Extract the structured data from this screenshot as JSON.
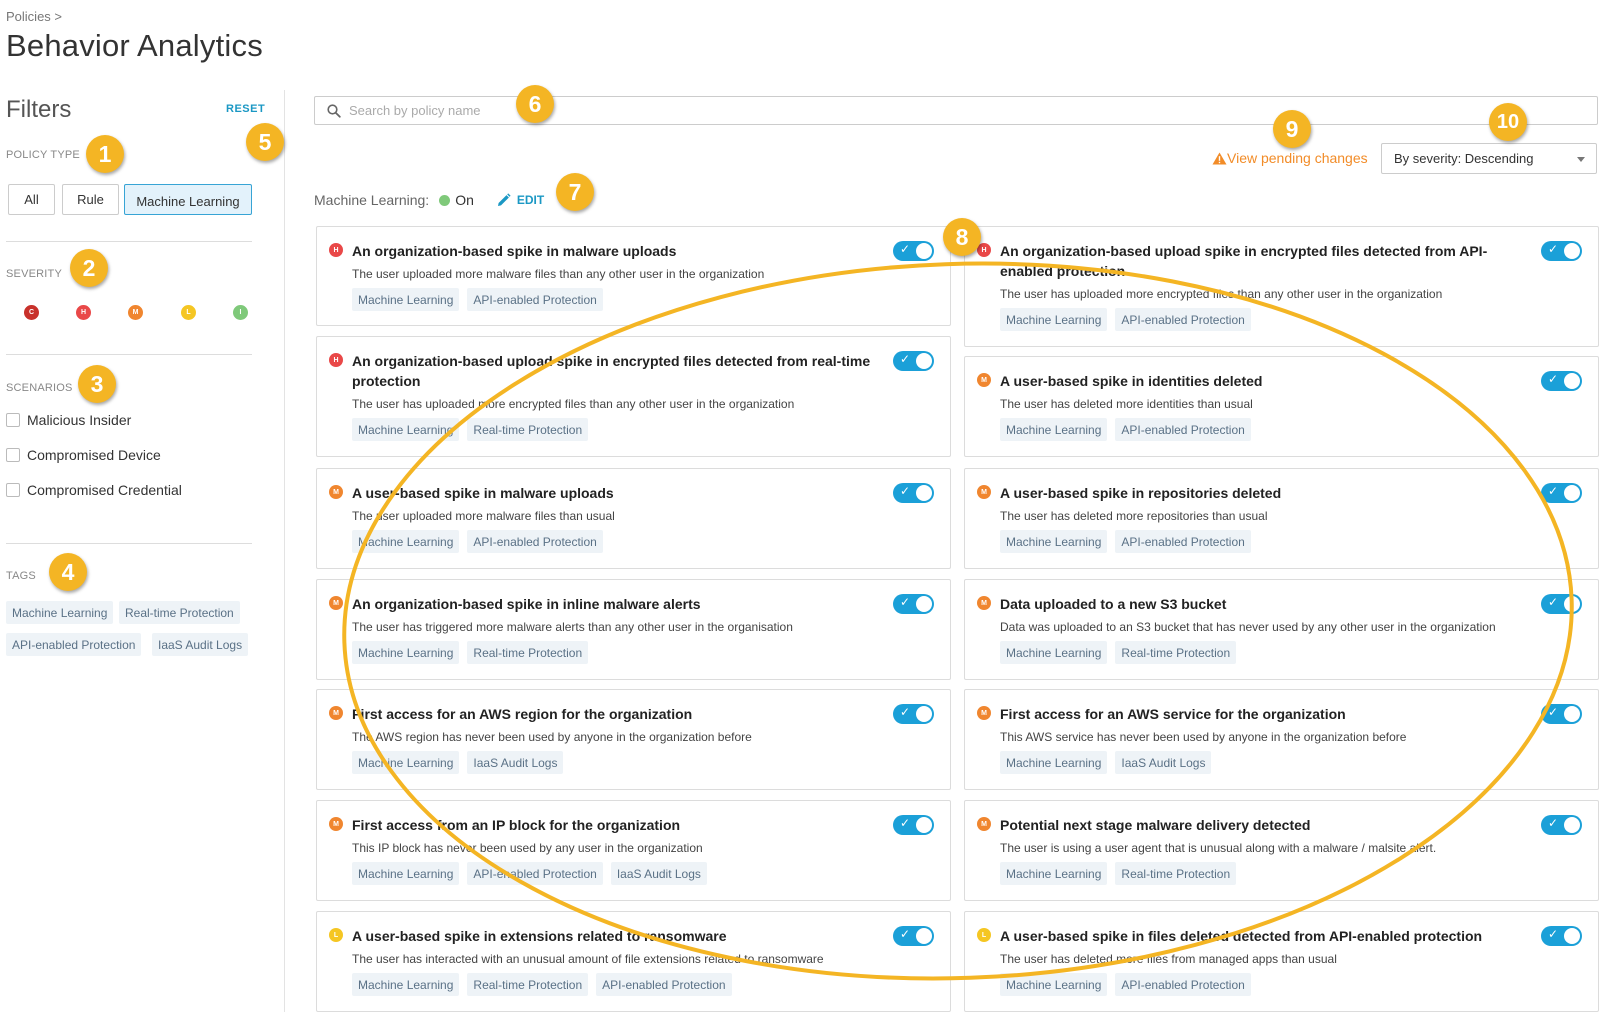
{
  "breadcrumb": "Policies >",
  "page_title": "Behavior Analytics",
  "filters": {
    "title": "Filters",
    "reset_label": "RESET",
    "policy_type_label": "POLICY TYPE",
    "policy_types": [
      "All",
      "Rule",
      "Machine Learning"
    ],
    "severity_label": "SEVERITY",
    "severities": [
      {
        "letter": "C",
        "color": "#c8312b"
      },
      {
        "letter": "H",
        "color": "#e94848"
      },
      {
        "letter": "M",
        "color": "#f0862f"
      },
      {
        "letter": "L",
        "color": "#f5c623"
      },
      {
        "letter": "I",
        "color": "#7fc97a"
      }
    ],
    "scenarios_label": "SCENARIOS",
    "scenarios": [
      "Malicious Insider",
      "Compromised Device",
      "Compromised Credential"
    ],
    "tags_label": "TAGS",
    "tags": [
      "Machine Learning",
      "Real-time Protection",
      "API-enabled Protection",
      "IaaS Audit Logs"
    ]
  },
  "search": {
    "placeholder": "Search by policy name"
  },
  "pending_changes_label": "View pending changes",
  "sort": {
    "selected": "By severity: Descending"
  },
  "machine_learning": {
    "label": "Machine Learning:",
    "status": "On",
    "edit_label": "EDIT"
  },
  "policies": [
    {
      "severity": "H",
      "title": "An organization-based spike in malware uploads",
      "description": "The user uploaded more malware files than any other user in the organization",
      "tags": [
        "Machine Learning",
        "API-enabled Protection"
      ],
      "enabled": true
    },
    {
      "severity": "H",
      "title": "An organization-based upload spike in encrypted files detected from API-enabled protection",
      "description": "The user has uploaded more encrypted files than any other user in the organization",
      "tags": [
        "Machine Learning",
        "API-enabled Protection"
      ],
      "enabled": true
    },
    {
      "severity": "H",
      "title": "An organization-based upload spike in encrypted files detected from real-time protection",
      "description": "The user has uploaded more encrypted files than any other user in the organization",
      "tags": [
        "Machine Learning",
        "Real-time Protection"
      ],
      "enabled": true
    },
    {
      "severity": "M",
      "title": "A user-based spike in identities deleted",
      "description": "The user has deleted more identities than usual",
      "tags": [
        "Machine Learning",
        "API-enabled Protection"
      ],
      "enabled": true
    },
    {
      "severity": "M",
      "title": "A user-based spike in malware uploads",
      "description": "The user uploaded more malware files than usual",
      "tags": [
        "Machine Learning",
        "API-enabled Protection"
      ],
      "enabled": true
    },
    {
      "severity": "M",
      "title": "A user-based spike in repositories deleted",
      "description": "The user has deleted more repositories than usual",
      "tags": [
        "Machine Learning",
        "API-enabled Protection"
      ],
      "enabled": true
    },
    {
      "severity": "M",
      "title": "An organization-based spike in inline malware alerts",
      "description": "The user has triggered more malware alerts than any other user in the organisation",
      "tags": [
        "Machine Learning",
        "Real-time Protection"
      ],
      "enabled": true
    },
    {
      "severity": "M",
      "title": "Data uploaded to a new S3 bucket",
      "description": "Data was uploaded to an S3 bucket that has never used by any other user in the organization",
      "tags": [
        "Machine Learning",
        "Real-time Protection"
      ],
      "enabled": true
    },
    {
      "severity": "M",
      "title": "First access for an AWS region for the organization",
      "description": "The AWS region has never been used by anyone in the organization before",
      "tags": [
        "Machine Learning",
        "IaaS Audit Logs"
      ],
      "enabled": true
    },
    {
      "severity": "M",
      "title": "First access for an AWS service for the organization",
      "description": "This AWS service has never been used by anyone in the organization before",
      "tags": [
        "Machine Learning",
        "IaaS Audit Logs"
      ],
      "enabled": true
    },
    {
      "severity": "M",
      "title": "First access from an IP block for the organization",
      "description": "This IP block has never been used by any user in the organization",
      "tags": [
        "Machine Learning",
        "API-enabled Protection",
        "IaaS Audit Logs"
      ],
      "enabled": true
    },
    {
      "severity": "M",
      "title": "Potential next stage malware delivery detected",
      "description": "The user is using a user agent that is unusual along with a malware / malsite alert.",
      "tags": [
        "Machine Learning",
        "Real-time Protection"
      ],
      "enabled": true
    },
    {
      "severity": "L",
      "title": "A user-based spike in extensions related to ransomware",
      "description": "The user has interacted with an unusual amount of file extensions related to ransomware",
      "tags": [
        "Machine Learning",
        "Real-time Protection",
        "API-enabled Protection"
      ],
      "enabled": true
    },
    {
      "severity": "L",
      "title": "A user-based spike in files deleted detected from API-enabled protection",
      "description": "The user has deleted more files from managed apps than usual",
      "tags": [
        "Machine Learning",
        "API-enabled Protection"
      ],
      "enabled": true
    }
  ],
  "severity_colors": {
    "C": "#c8312b",
    "H": "#e94848",
    "M": "#f0862f",
    "L": "#f5c623",
    "I": "#7fc97a"
  },
  "callouts": [
    "1",
    "2",
    "3",
    "4",
    "5",
    "6",
    "7",
    "8",
    "9",
    "10"
  ],
  "accent_color": "#1ba0d8",
  "callout_color": "#f4b524"
}
